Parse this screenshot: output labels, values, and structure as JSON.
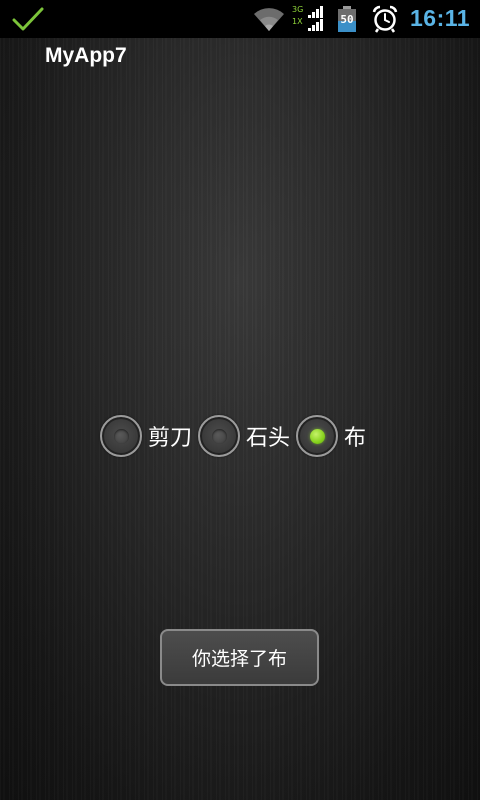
{
  "status_bar": {
    "network_3g": "3G",
    "network_1x": "1X",
    "battery": "50",
    "time": "16:11",
    "icons": [
      "check-icon",
      "wifi-icon",
      "signal-icon",
      "battery-icon",
      "alarm-icon"
    ],
    "time_color": "#5ab4e6"
  },
  "app": {
    "title": "MyApp7"
  },
  "radio_group": {
    "options": [
      {
        "label": "剪刀",
        "checked": false
      },
      {
        "label": "石头",
        "checked": false
      },
      {
        "label": "布",
        "checked": true
      }
    ],
    "checked_color": "#86d21c"
  },
  "toast": {
    "text": "你选择了布"
  }
}
